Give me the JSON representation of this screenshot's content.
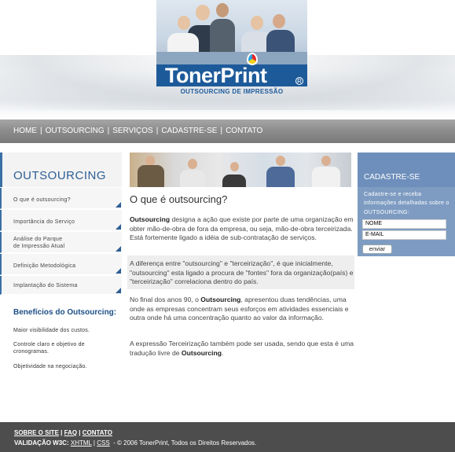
{
  "brand": {
    "logo_text": "TonerPrint",
    "tagline": "OUTSOURCING DE IMPRESSÃO",
    "colors": {
      "primary": "#1d5a9a",
      "nav": "#8d8d8d",
      "accent_box": "#7e9cc2",
      "footer": "#4d4d4d"
    }
  },
  "nav": {
    "items": [
      "HOME",
      "OUTSOURCING",
      "SERVIÇOS",
      "CADASTRE-SE",
      "CONTATO"
    ],
    "separator": "|"
  },
  "sidebar": {
    "title": "OUTSOURCING",
    "items": [
      {
        "label": "O que é outsourcing?"
      },
      {
        "label": "Importância do Serviço"
      },
      {
        "label": "Análise do Parque",
        "label2": "de Impressão Atual"
      },
      {
        "label": "Definição Metodológica"
      },
      {
        "label": "Implantação do Sistema"
      }
    ],
    "benefits_title": "Benefícios do Outsourcing:",
    "benefits": [
      {
        "line1": "Maior visibilidade dos custos."
      },
      {
        "line1": "Controle claro e objetivo de",
        "line2": "cronogramas."
      },
      {
        "line1": "Objetividade na negociação."
      }
    ]
  },
  "content": {
    "title": "O que é outsourcing?",
    "p1_bold": "Outsourcing",
    "p1_rest": " designa a ação que existe por parte de uma organização em obter mão-de-obra de fora da empresa, ou seja, mão-de-obra terceirizada. Está fortemente ligado a idéia de sub-contratação de serviços.",
    "p2": "A diferença entre \"outsourcing\" e \"terceirização\", é que inicialmente, \"outsourcing\" esta ligado a procura de \"fontes\" fora da organização(país) e \"terceirização\" correlaciona dentro do país.",
    "p3_a": "No final dos anos 90, o ",
    "p3_bold": "Outsourcing",
    "p3_b": ", apresentou duas tendências, uma onde as empresas concentram seus esforços em atividades essenciais e outra onde há uma concentração quanto ao valor da informação.",
    "p4_a": "A expressão Terceirização também pode ser usada, sendo que esta é uma tradução livre de ",
    "p4_bold": "Outsourcing",
    "p4_b": "."
  },
  "signup": {
    "title": "CADASTRE-SE",
    "text": "Cadastre-se e receba informações detalhadas sobre o OUTSOURCING:",
    "name_value": "NOME",
    "email_value": "E-MAIL",
    "button": "enviar"
  },
  "footer": {
    "link_site": "SOBRE O SITE",
    "link_faq": "FAQ",
    "link_contact": "CONTATO",
    "validation_label": "VALIDAÇÃO W3C:",
    "xhtml": "XHTML",
    "css": "CSS",
    "copyright": "© 2006 TonerPrint, Todos os Direitos Reservados."
  }
}
